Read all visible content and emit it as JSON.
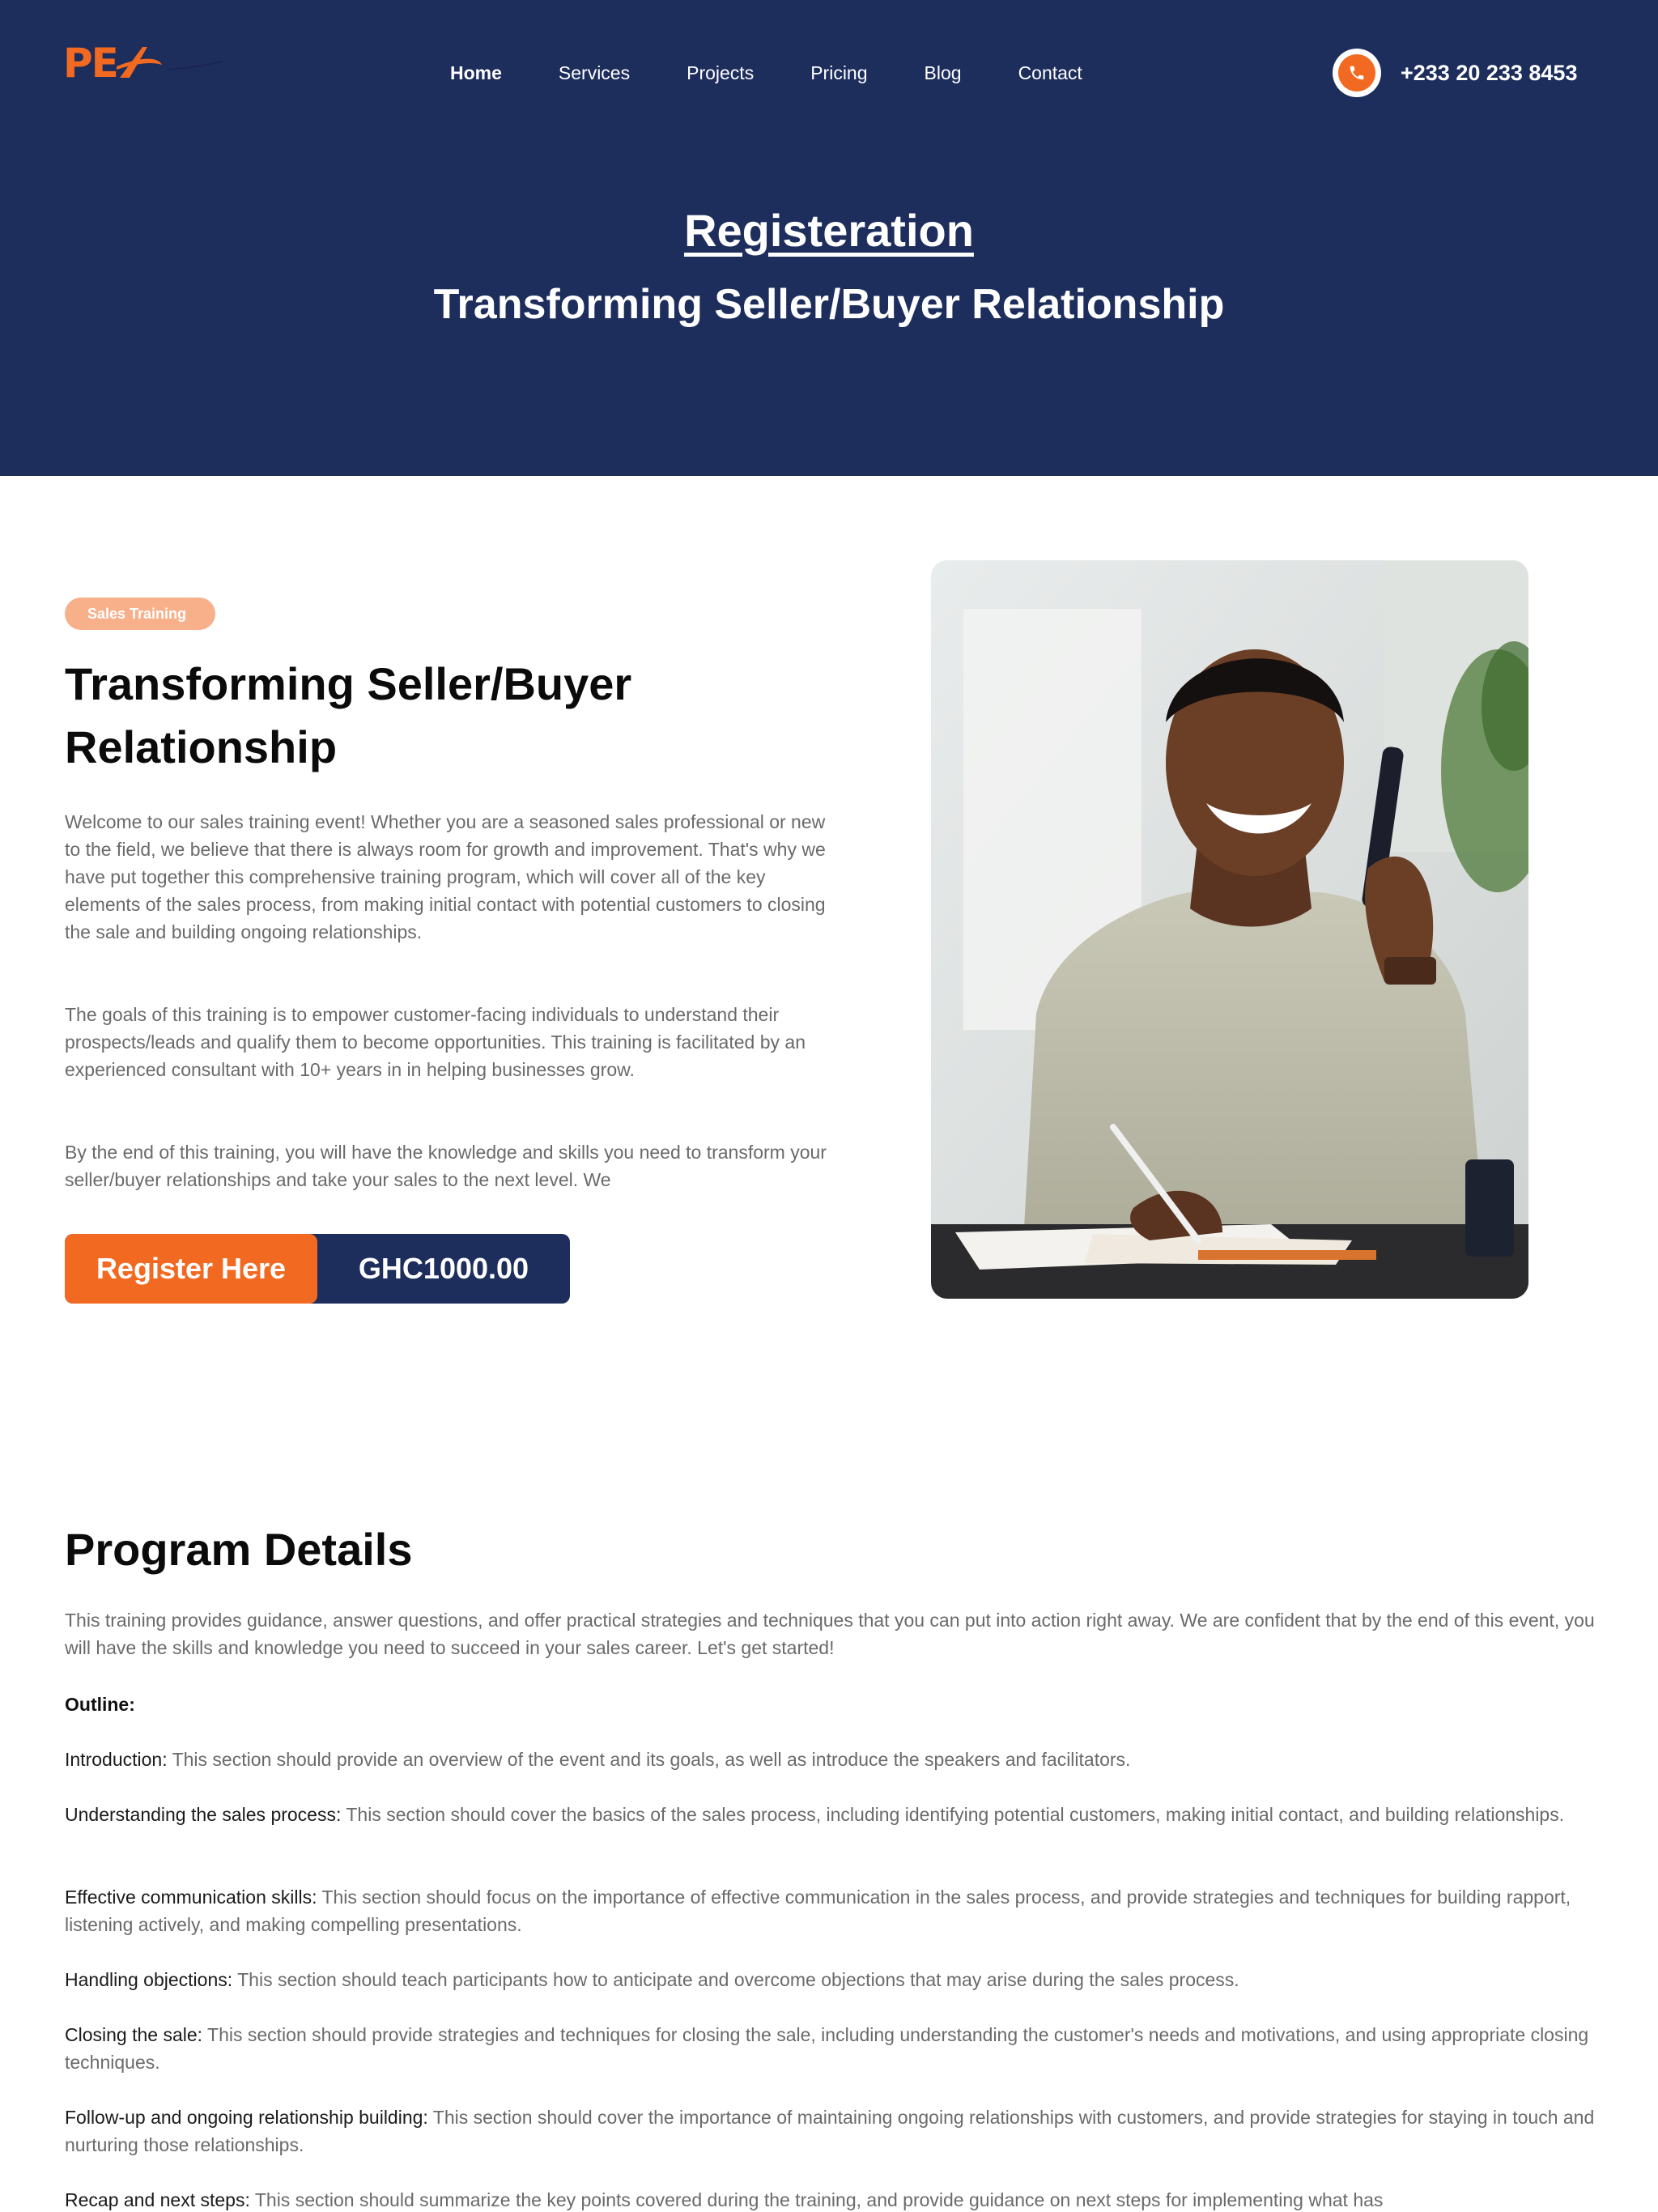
{
  "colors": {
    "navy": "#1d2d5c",
    "orange": "#f26a21",
    "badge": "#f7b08a"
  },
  "brand": {
    "logo_text": "PE"
  },
  "nav": {
    "items": [
      {
        "label": "Home",
        "active": true
      },
      {
        "label": "Services"
      },
      {
        "label": "Projects"
      },
      {
        "label": "Pricing"
      },
      {
        "label": "Blog"
      },
      {
        "label": "Contact"
      }
    ]
  },
  "contact": {
    "phone_icon": "phone-icon",
    "phone": "+233 20 233 8453"
  },
  "hero": {
    "title": "Registeration",
    "subtitle": "Transforming Seller/Buyer Relationship"
  },
  "intro": {
    "badge": "Sales Training",
    "title": "Transforming Seller/Buyer Relationship",
    "paragraphs": [
      "Welcome to our sales training event! Whether you are a seasoned sales professional or new to the field, we believe that there is always room for growth and improvement. That's why we have put together this comprehensive training program, which will cover all of the key elements of the sales process, from making initial contact with potential customers to closing the sale and building ongoing relationships.",
      "The goals of this training is to empower customer-facing individuals to understand their prospects/leads and qualify them to become opportunities. This training is facilitated by an experienced consultant with 10+ years in in helping businesses grow.",
      "By the end of this training, you will have the knowledge and skills you need to transform your seller/buyer relationships and take your sales to the next level. We"
    ],
    "register_label": "Register Here",
    "price": "GHC1000.00"
  },
  "program": {
    "title": "Program Details",
    "intro": "This training provides guidance, answer questions, and offer practical strategies and techniques that you can put into action right away. We are confident that by the end of this event, you will have the skills and knowledge you need to succeed in your sales career. Let's get started!",
    "outline_label": "Outline:",
    "items": [
      {
        "key": "Introduction:",
        "text": " This section should provide an overview of the event and its goals, as well as introduce the speakers and facilitators."
      },
      {
        "key": "Understanding the sales process:",
        "text": " This section should cover the basics of the sales process, including identifying potential customers, making initial contact, and building relationships."
      },
      {
        "key": "Effective communication skills:",
        "text": " This section should focus on the importance of effective communication in the sales process, and provide strategies and techniques for building rapport, listening actively, and making compelling presentations."
      },
      {
        "key": "Handling objections:",
        "text": " This section should teach participants how to anticipate and overcome objections that may arise during the sales process."
      },
      {
        "key": "Closing the sale:",
        "text": " This section should provide strategies and techniques for closing the sale, including understanding the customer's needs and motivations, and using appropriate closing techniques."
      },
      {
        "key": "Follow-up and ongoing relationship building:",
        "text": " This section should cover the importance of maintaining ongoing relationships with customers, and provide strategies for staying in touch and nurturing those relationships."
      },
      {
        "key": "Recap and next steps:",
        "text": " This section should summarize the key points covered during the training, and provide guidance on next steps for implementing what has"
      }
    ]
  }
}
